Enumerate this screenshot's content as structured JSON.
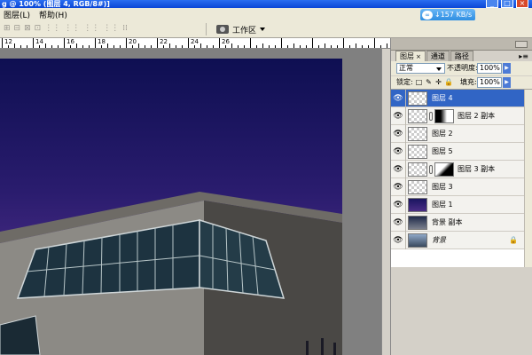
{
  "titlebar": {
    "title": "g @ 100% (图层 4, RGB/8#)]"
  },
  "window_controls": {
    "minimize": "_",
    "maximize": "□",
    "close": "×"
  },
  "menu": {
    "items": [
      "图层(L)",
      "帮助(H)"
    ]
  },
  "network": {
    "speed": "↓157 KB/s",
    "cloud_glyph": "∞"
  },
  "options": {
    "icons": [
      "⊞",
      "⊟",
      "⊠",
      "⊡",
      "⋮⋮",
      "⋮⋮",
      "⋮⋮",
      "⋮⋮",
      "⁞⁞"
    ],
    "workspace_label": "工作区"
  },
  "ruler": {
    "labels": [
      "12",
      "14",
      "16",
      "18",
      "20",
      "22",
      "24",
      "26"
    ]
  },
  "panel": {
    "tabs": [
      {
        "label": "图层",
        "close": "×"
      },
      {
        "label": "通道"
      },
      {
        "label": "路径"
      }
    ],
    "menu_glyph": "▸≡",
    "blend_mode": "正常",
    "opacity_label": "不透明度:",
    "opacity_value": "100%",
    "lock_label": "锁定:",
    "lock_icons": [
      "□",
      "✎",
      "✛",
      "🔒"
    ],
    "fill_label": "填充:",
    "fill_value": "100%",
    "arrow_glyph": "▶",
    "eye_glyph": "👁",
    "lock_glyph": "🔒"
  },
  "layers": [
    {
      "name": "图层 4",
      "thumb": "transparent",
      "selected": true
    },
    {
      "name": "图层 2 副本",
      "thumb": "transparent",
      "mask": "a"
    },
    {
      "name": "图层 2",
      "thumb": "transparent"
    },
    {
      "name": "图层 5",
      "thumb": "transparent"
    },
    {
      "name": "图层 3 副本",
      "thumb": "transparent",
      "mask": "b"
    },
    {
      "name": "图层 3",
      "thumb": "transparent"
    },
    {
      "name": "图层 1",
      "thumb": "night"
    },
    {
      "name": "背景 副本",
      "thumb": "scene"
    },
    {
      "name": "背景",
      "thumb": "photo",
      "locked": true,
      "italic": true
    }
  ]
}
